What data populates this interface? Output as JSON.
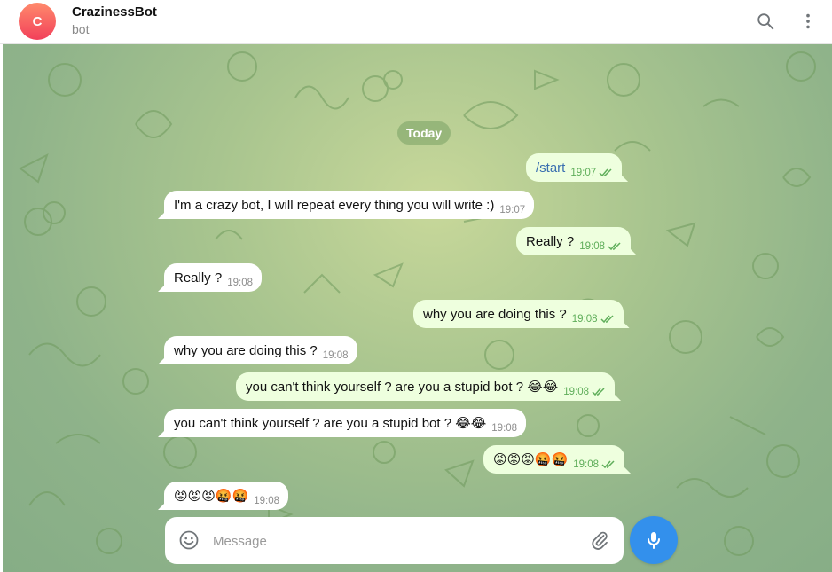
{
  "header": {
    "avatar_letter": "C",
    "title": "CrazinessBot",
    "subtitle": "bot",
    "search_icon": "search-icon",
    "more_icon": "more-vertical-icon"
  },
  "chat": {
    "date_label": "Today",
    "messages": [
      {
        "direction": "out",
        "text": "/start",
        "time": "19:07",
        "read": true
      },
      {
        "direction": "in",
        "text": "I'm a crazy bot, I will repeat every thing you will write :)",
        "time": "19:07"
      },
      {
        "direction": "out",
        "text": "Really ?",
        "time": "19:08",
        "read": true
      },
      {
        "direction": "in",
        "text": "Really ?",
        "time": "19:08"
      },
      {
        "direction": "out",
        "text": "why you are doing this ?",
        "time": "19:08",
        "read": true
      },
      {
        "direction": "in",
        "text": "why you are doing this ?",
        "time": "19:08"
      },
      {
        "direction": "out",
        "text": "you can't think yourself ? are you a stupid bot ? 😂😂",
        "time": "19:08",
        "read": true
      },
      {
        "direction": "in",
        "text": "you can't think yourself ? are you a stupid bot ? 😂😂",
        "time": "19:08"
      },
      {
        "direction": "out",
        "text": "😡😡😡🤬🤬",
        "time": "19:08",
        "read": true
      },
      {
        "direction": "in",
        "text": "😡😡😡🤬🤬",
        "time": "19:08"
      }
    ]
  },
  "composer": {
    "placeholder": "Message",
    "emoji_icon": "smile-icon",
    "attach_icon": "paperclip-icon",
    "send_icon": "microphone-icon"
  },
  "colors": {
    "accent": "#3390ec",
    "outgoing_bubble": "#eeffde",
    "incoming_bubble": "#ffffff",
    "read_ticks": "#5fae5a"
  }
}
